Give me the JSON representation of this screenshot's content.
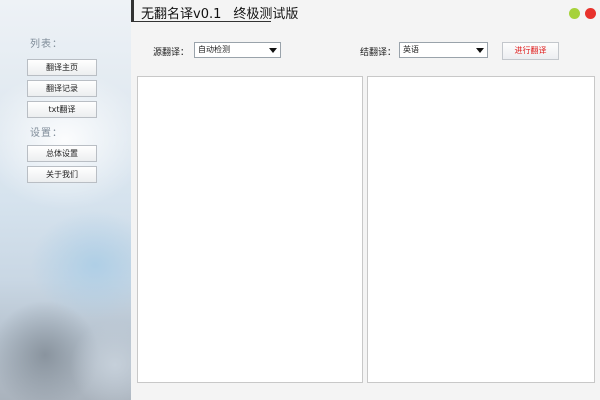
{
  "app": {
    "title": "无翻名译v0.1",
    "edition": "终极测试版"
  },
  "window_controls": {
    "minimize_color": "#a6d23a",
    "close_color": "#e8322c"
  },
  "sidebar": {
    "list_label": "列表：",
    "list_items": [
      {
        "label": "翻译主页"
      },
      {
        "label": "翻译记录"
      },
      {
        "label": "txt翻译"
      }
    ],
    "settings_label": "设置：",
    "settings_items": [
      {
        "label": "总体设置"
      },
      {
        "label": "关于我们"
      }
    ]
  },
  "translate": {
    "source_label": "源翻译：",
    "source_value": "自动检测",
    "target_label": "结翻译：",
    "target_value": "英语",
    "go_button": "进行翻译",
    "go_button_color": "#e02020",
    "source_text": "",
    "result_text": ""
  }
}
